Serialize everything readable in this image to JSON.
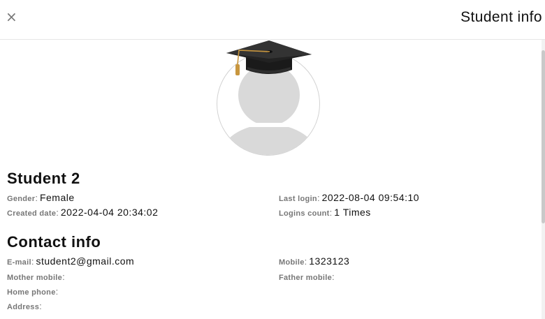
{
  "header": {
    "close_label": "×",
    "title": "Student info"
  },
  "profile": {
    "name": "Student 2",
    "fields": {
      "gender": {
        "label": "Gender",
        "value": "Female"
      },
      "created_date": {
        "label": "Created date",
        "value": "2022-04-04 20:34:02"
      },
      "last_login": {
        "label": "Last login",
        "value": "2022-08-04 09:54:10"
      },
      "logins_count": {
        "label": "Logins count",
        "value": "1 Times"
      }
    }
  },
  "contact": {
    "title": "Contact info",
    "fields": {
      "email": {
        "label": "E-mail",
        "value": "student2@gmail.com"
      },
      "mobile": {
        "label": "Mobile",
        "value": "1323123"
      },
      "mother_mobile": {
        "label": "Mother mobile",
        "value": ""
      },
      "father_mobile": {
        "label": "Father mobile",
        "value": ""
      },
      "home_phone": {
        "label": "Home phone",
        "value": ""
      },
      "address": {
        "label": "Address",
        "value": ""
      }
    }
  },
  "colors": {
    "label": "#777777",
    "text": "#111111",
    "border": "#d2d2d2",
    "placeholder_avatar": "#d9d9d9",
    "cap": "#1a1a1a",
    "tassel": "#c8963e"
  },
  "icons": {
    "close": "close-icon",
    "avatar": "user-placeholder-icon",
    "cap": "graduation-cap-icon"
  }
}
